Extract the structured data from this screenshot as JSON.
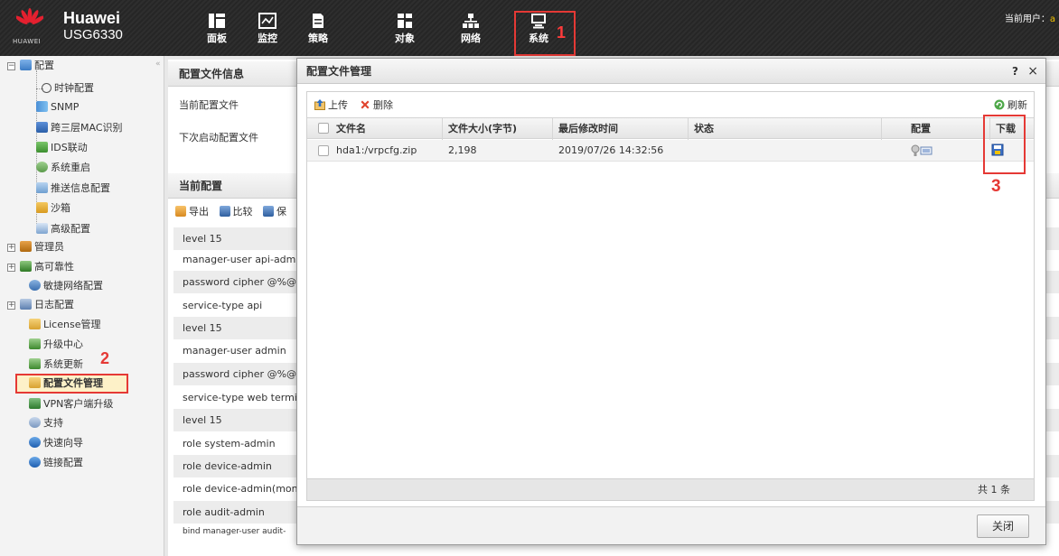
{
  "header": {
    "logo_text": "HUAWEI",
    "product_name": "Huawei",
    "product_model": "USG6330",
    "current_user_label": "当前用户：",
    "current_user_value": "a",
    "nav": [
      {
        "label": "面板",
        "icon": "dashboard-icon"
      },
      {
        "label": "监控",
        "icon": "monitor-chart-icon"
      },
      {
        "label": "策略",
        "icon": "policy-document-icon"
      },
      {
        "label": "对象",
        "icon": "object-blocks-icon"
      },
      {
        "label": "网络",
        "icon": "network-tree-icon"
      },
      {
        "label": "系统",
        "icon": "system-computer-icon",
        "active": true
      }
    ]
  },
  "callouts": {
    "step1": "1",
    "step2": "2",
    "step3": "3"
  },
  "sidebar": {
    "items": [
      {
        "label": "配置",
        "icon": "config-folder-icon",
        "expander": "−"
      },
      {
        "label": "时钟配置",
        "icon": "clock-icon"
      },
      {
        "label": "SNMP",
        "icon": "snmp-icon"
      },
      {
        "label": "跨三层MAC识别",
        "icon": "mac-identify-icon"
      },
      {
        "label": "IDS联动",
        "icon": "ids-shield-icon"
      },
      {
        "label": "系统重启",
        "icon": "restart-icon"
      },
      {
        "label": "推送信息配置",
        "icon": "push-message-icon"
      },
      {
        "label": "沙箱",
        "icon": "sandbox-icon"
      },
      {
        "label": "高级配置",
        "icon": "advanced-config-icon"
      },
      {
        "label": "管理员",
        "icon": "admin-icon",
        "expander": "+"
      },
      {
        "label": "高可靠性",
        "icon": "high-availability-icon",
        "expander": "+"
      },
      {
        "label": "敏捷网络配置",
        "icon": "agile-network-icon"
      },
      {
        "label": "日志配置",
        "icon": "log-config-icon",
        "expander": "+"
      },
      {
        "label": "License管理",
        "icon": "license-icon"
      },
      {
        "label": "升级中心",
        "icon": "upgrade-center-icon"
      },
      {
        "label": "系统更新",
        "icon": "system-update-icon"
      },
      {
        "label": "配置文件管理",
        "icon": "config-file-icon",
        "selected": true
      },
      {
        "label": "VPN客户端升级",
        "icon": "vpn-client-icon"
      },
      {
        "label": "支持",
        "icon": "support-icon"
      },
      {
        "label": "快速向导",
        "icon": "quick-wizard-icon"
      },
      {
        "label": "链接配置",
        "icon": "link-config-icon"
      }
    ]
  },
  "background": {
    "config_info_title": "配置文件信息",
    "current_config_file_label": "当前配置文件",
    "next_startup_label": "下次启动配置文件",
    "current_config_title": "当前配置",
    "toolbar": {
      "export": "导出",
      "compare": "比较",
      "save": "保"
    },
    "config_lines": [
      "level 15",
      "manager-user api-admin",
      "password cipher @%@%",
      "service-type api",
      "level 15",
      "manager-user admin",
      "password cipher @%@%",
      "service-type web terminal",
      "level 15",
      "role system-admin",
      "role device-admin",
      "role device-admin(monitor)",
      "role audit-admin",
      "bind manager-user audit-"
    ]
  },
  "dialog": {
    "title": "配置文件管理",
    "help": "?",
    "close_x": "×",
    "toolbar": {
      "upload": "上传",
      "delete": "删除",
      "refresh": "刷新"
    },
    "columns": {
      "filename": "文件名",
      "size": "文件大小(字节)",
      "modified": "最后修改时间",
      "status": "状态",
      "config": "配置",
      "download": "下载"
    },
    "rows": [
      {
        "filename": "hda1:/vrpcfg.zip",
        "size": "2,198",
        "modified": "2019/07/26 14:32:56",
        "status": ""
      }
    ],
    "footer_count": "共 1 条",
    "close_button": "关闭"
  },
  "colors": {
    "header_bg": "#2e2e2e",
    "highlight_red": "#e53935",
    "selected_bg": "#fdf1c8"
  }
}
